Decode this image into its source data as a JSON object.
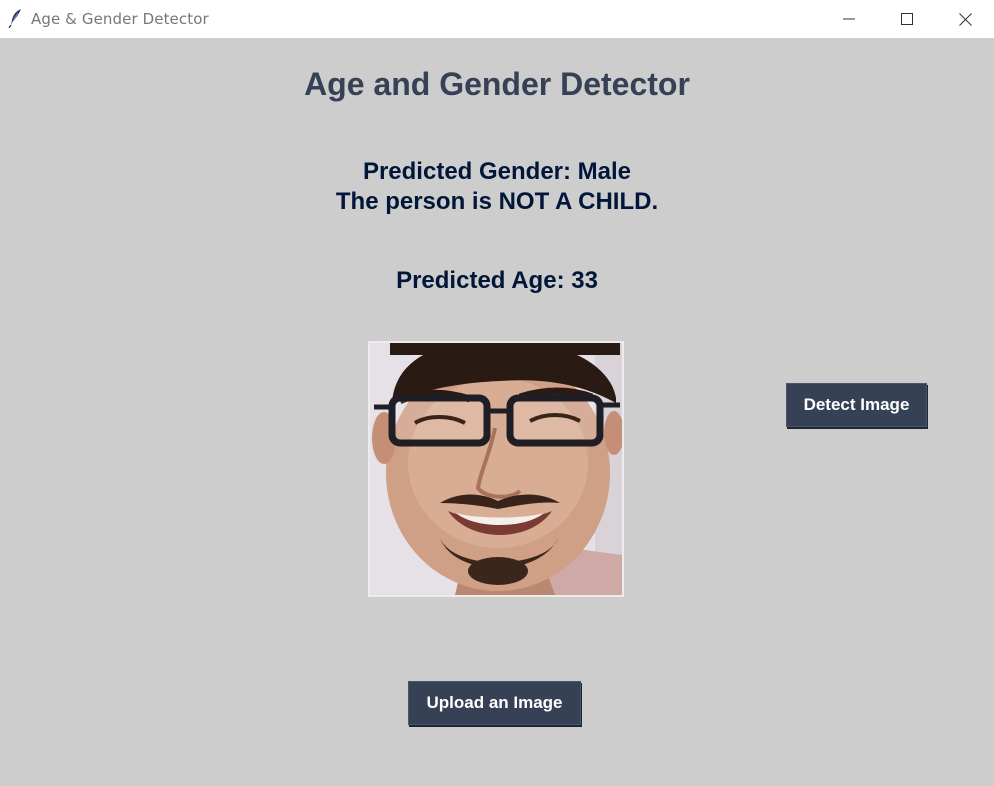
{
  "window": {
    "title": "Age & Gender Detector",
    "icon": "feather-icon",
    "controls": [
      "minimize-icon",
      "maximize-icon",
      "close-icon"
    ]
  },
  "app": {
    "heading": "Age and Gender Detector",
    "gender_line": "Predicted Gender: Male",
    "child_line": "The person is NOT A CHILD.",
    "age_line": "Predicted Age: 33",
    "detect_button": "Detect Image",
    "upload_button": "Upload an Image"
  },
  "colors": {
    "background": "#cdcdcd",
    "heading": "#364156",
    "result_text": "#011638",
    "button_bg": "#364156",
    "button_text": "#ffffff"
  }
}
